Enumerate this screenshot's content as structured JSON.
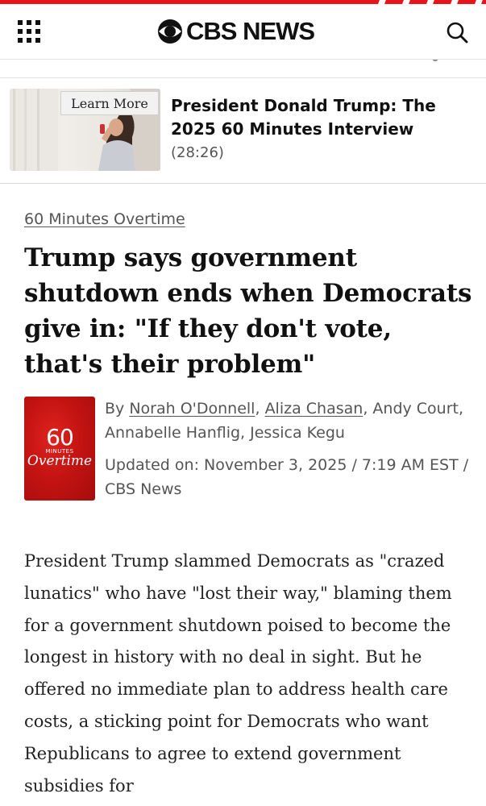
{
  "header": {
    "brand": "CBS NEWS",
    "accent_color": "#e8141b",
    "menu_icon": "grid-menu-icon",
    "search_icon": "search-icon"
  },
  "promo": {
    "button_label": "Learn More",
    "title": "President Donald Trump: The 2025 60 Minutes Interview",
    "duration": "(28:26)"
  },
  "article": {
    "section": "60 Minutes Overtime",
    "headline": "Trump says government shutdown ends when Democrats give in: \"If they don't vote, that's their problem\"",
    "logo": {
      "number": "60",
      "minutes": "MINUTES",
      "overtime": "Overtime"
    },
    "byline_prefix": "By ",
    "authors": [
      "Norah O'Donnell",
      "Aliza Chasan",
      "Andy Court",
      "Annabelle Hanflig",
      "Jessica Kegu"
    ],
    "sep": ", ",
    "updated": "Updated on: November 3, 2025 / 7:19 AM EST / CBS News",
    "body": "President Trump slammed Democrats as \"crazed lunatics\" who have \"lost their way,\" blaming them for a government shutdown poised to become the longest in history with no deal in sight. But he offered no immediate plan to address health care costs, a sticking point for Democrats who want Republicans to agree to extend government subsidies for"
  }
}
